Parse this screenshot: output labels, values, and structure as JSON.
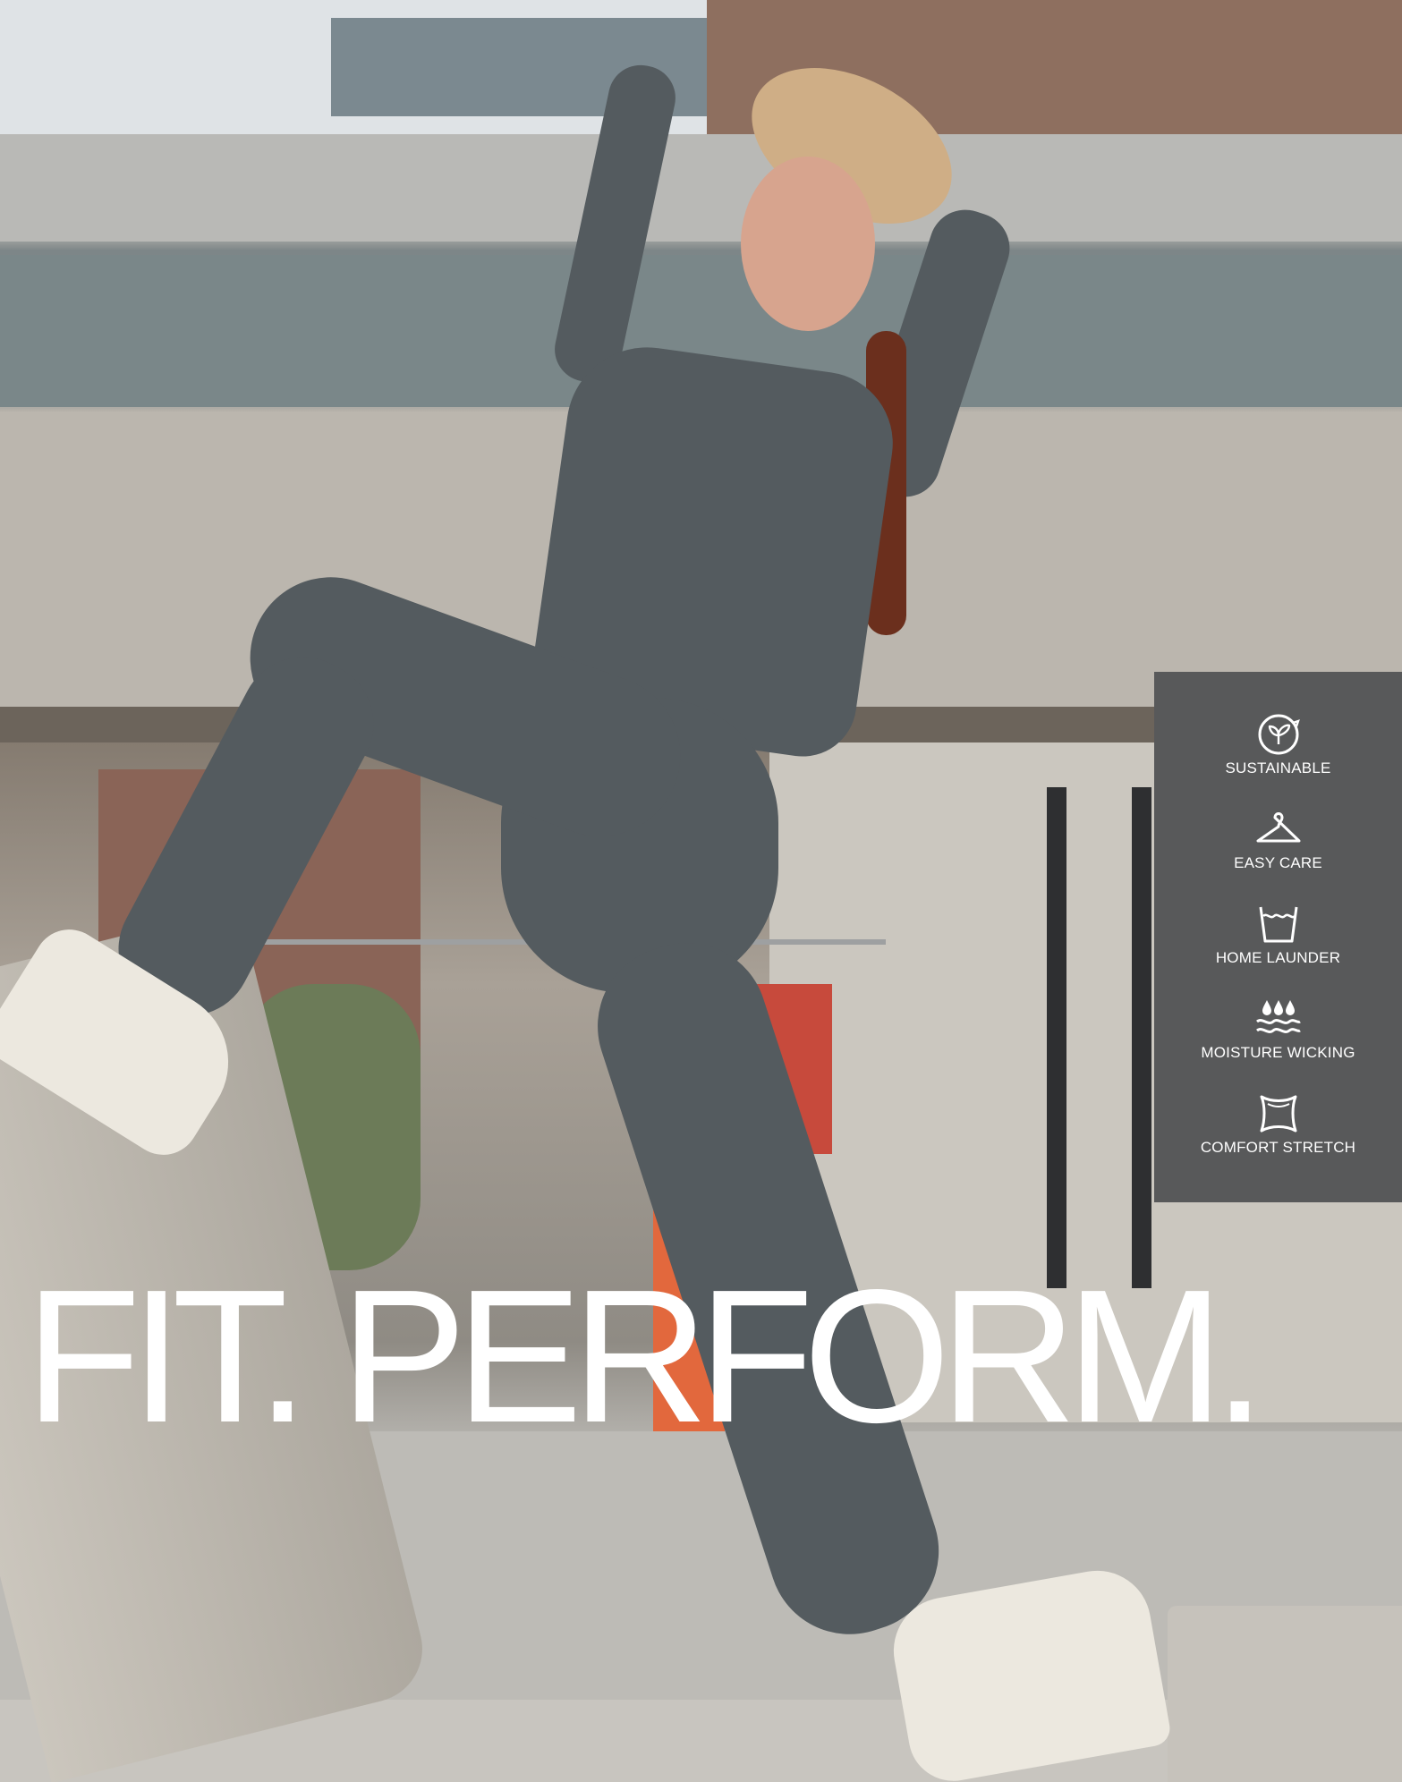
{
  "headline": "FIT. PERFORM.",
  "features": [
    {
      "label": "SUSTAINABLE",
      "icon": "sustainable-leaf-icon"
    },
    {
      "label": "EASY CARE",
      "icon": "hanger-icon"
    },
    {
      "label": "HOME LAUNDER",
      "icon": "wash-tub-icon"
    },
    {
      "label": "MOISTURE WICKING",
      "icon": "water-drops-icon"
    },
    {
      "label": "COMFORT STRETCH",
      "icon": "stretch-fabric-icon"
    }
  ],
  "colors": {
    "panel": "#58595a",
    "text": "#ffffff",
    "outfit": "#545b5f"
  }
}
